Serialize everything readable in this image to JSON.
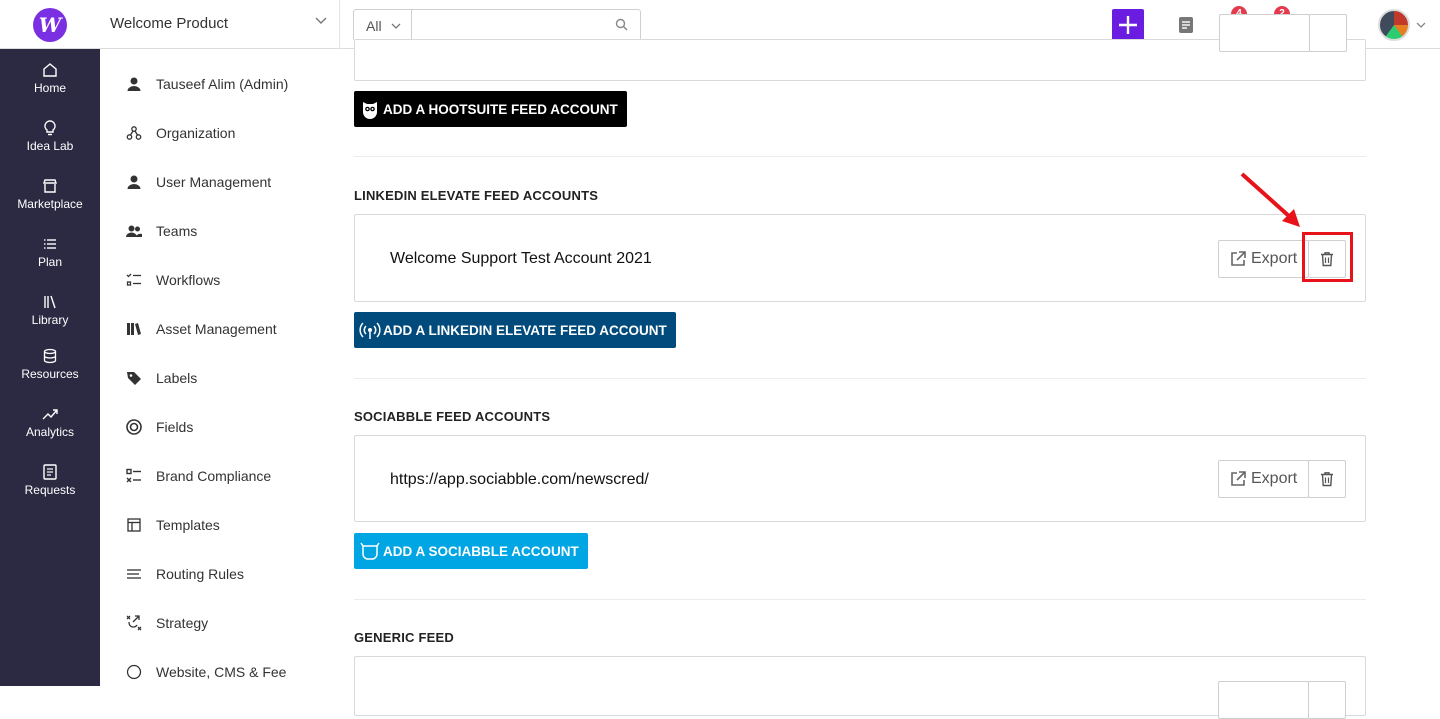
{
  "app": {
    "logo_letter": "W",
    "product_name": "Welcome Product",
    "accent_color": "#6a1de0"
  },
  "search": {
    "scope": "All",
    "value": "",
    "placeholder": ""
  },
  "notifications": {
    "bell_count": "4",
    "tasks_count": "2"
  },
  "rail": {
    "items": [
      {
        "label": "Home",
        "icon": "home-icon"
      },
      {
        "label": "Idea Lab",
        "icon": "lightbulb-icon"
      },
      {
        "label": "Marketplace",
        "icon": "store-icon"
      },
      {
        "label": "Plan",
        "icon": "list-icon"
      },
      {
        "label": "Library",
        "icon": "library-icon"
      },
      {
        "label": "Resources",
        "icon": "database-icon"
      },
      {
        "label": "Analytics",
        "icon": "trend-icon"
      },
      {
        "label": "Requests",
        "icon": "form-icon"
      }
    ]
  },
  "settings": {
    "items": [
      {
        "label": "Tauseef Alim (Admin)",
        "icon": "person-icon"
      },
      {
        "label": "Organization",
        "icon": "org-icon"
      },
      {
        "label": "User Management",
        "icon": "person-icon"
      },
      {
        "label": "Teams",
        "icon": "team-icon"
      },
      {
        "label": "Workflows",
        "icon": "workflow-icon"
      },
      {
        "label": "Asset Management",
        "icon": "books-icon"
      },
      {
        "label": "Labels",
        "icon": "tag-icon"
      },
      {
        "label": "Fields",
        "icon": "target-icon"
      },
      {
        "label": "Brand Compliance",
        "icon": "checklist-icon"
      },
      {
        "label": "Templates",
        "icon": "template-icon"
      },
      {
        "label": "Routing Rules",
        "icon": "lines-icon"
      },
      {
        "label": "Strategy",
        "icon": "strategy-icon"
      },
      {
        "label": "Website, CMS & Fee",
        "icon": "website-icon"
      }
    ]
  },
  "main": {
    "hootsuite": {
      "add_label": "ADD A HOOTSUITE FEED ACCOUNT",
      "color": "#000000"
    },
    "linkedin": {
      "title": "LINKEDIN ELEVATE FEED ACCOUNTS",
      "account": "Welcome Support Test Account 2021",
      "export_label": "Export",
      "add_label": "ADD A LINKEDIN ELEVATE FEED ACCOUNT",
      "color": "#004b7c"
    },
    "sociabble": {
      "title": "SOCIABBLE FEED ACCOUNTS",
      "account": "https://app.sociabble.com/newscred/",
      "export_label": "Export",
      "add_label": "ADD A SOCIABBLE ACCOUNT",
      "color": "#00a5e3"
    },
    "generic": {
      "title": "GENERIC FEED"
    }
  },
  "annotation_color": "#e8131a"
}
